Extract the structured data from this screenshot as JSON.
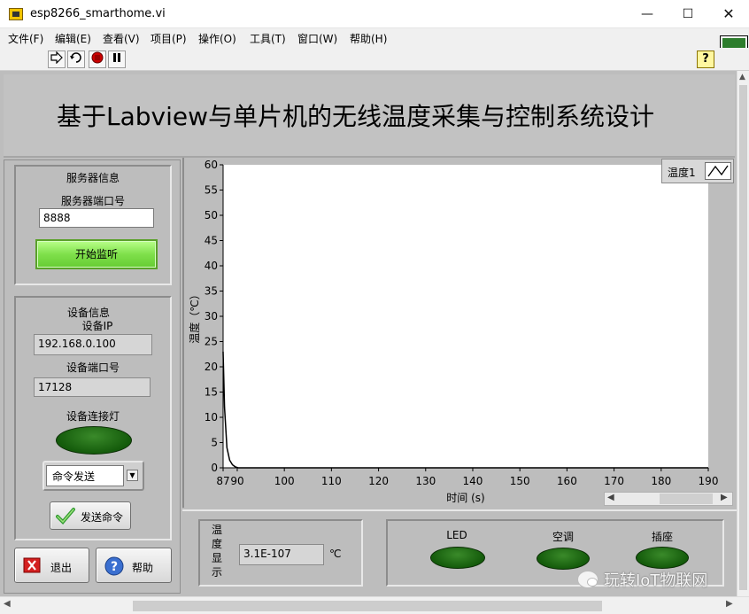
{
  "window": {
    "title": "esp8266_smarthome.vi",
    "min_glyph": "—",
    "max_glyph": "☐",
    "close_glyph": "✕"
  },
  "menu": [
    "文件(F)",
    "编辑(E)",
    "查看(V)",
    "项目(P)",
    "操作(O)",
    "工具(T)",
    "窗口(W)",
    "帮助(H)"
  ],
  "toolbar": {
    "icons": [
      "run-arrow-icon",
      "run-continuously-icon",
      "abort-icon",
      "pause-icon"
    ],
    "help_glyph": "?",
    "vi_icon_number": "1"
  },
  "heading": "基于Labview与单片机的无线温度采集与控制系统设计",
  "server": {
    "group_label": "服务器信息",
    "port_label": "服务器端口号",
    "port_value": "8888",
    "listen_button": "开始监听"
  },
  "device": {
    "group_label": "设备信息",
    "ip_label": "设备IP",
    "ip_value": "192.168.0.100",
    "port_label": "设备端口号",
    "port_value": "17128",
    "led_label": "设备连接灯",
    "command_value": "命令发送",
    "send_button": "发送命令"
  },
  "actions": {
    "exit_button": "退出",
    "help_button": "帮助"
  },
  "chart_data": {
    "type": "line",
    "title": "",
    "xlabel": "时间 (s)",
    "ylabel": "温度（℃）",
    "xlim": [
      87,
      190
    ],
    "ylim": [
      0,
      60
    ],
    "x_ticks": [
      "87",
      "90",
      "100",
      "110",
      "120",
      "130",
      "140",
      "150",
      "160",
      "170",
      "180",
      "190"
    ],
    "y_ticks": [
      "0",
      "5",
      "10",
      "15",
      "20",
      "25",
      "30",
      "35",
      "40",
      "45",
      "50",
      "55",
      "60"
    ],
    "legend": "top-right",
    "grid": false,
    "series": [
      {
        "name": "温度1",
        "color": "#000000",
        "x": [
          87,
          87.3,
          87.8,
          88.4,
          89.0,
          89.6,
          90.2,
          190
        ],
        "y": [
          23,
          12,
          4,
          1.5,
          0.6,
          0.2,
          0,
          0
        ]
      }
    ]
  },
  "temperature": {
    "label_chars": [
      "温",
      "度",
      "显",
      "示"
    ],
    "value": "3.1E-107",
    "unit": "℃"
  },
  "outputs": {
    "led_label": "LED",
    "ac_label": "空调",
    "socket_label": "插座"
  },
  "watermark": "玩转IoT物联网"
}
